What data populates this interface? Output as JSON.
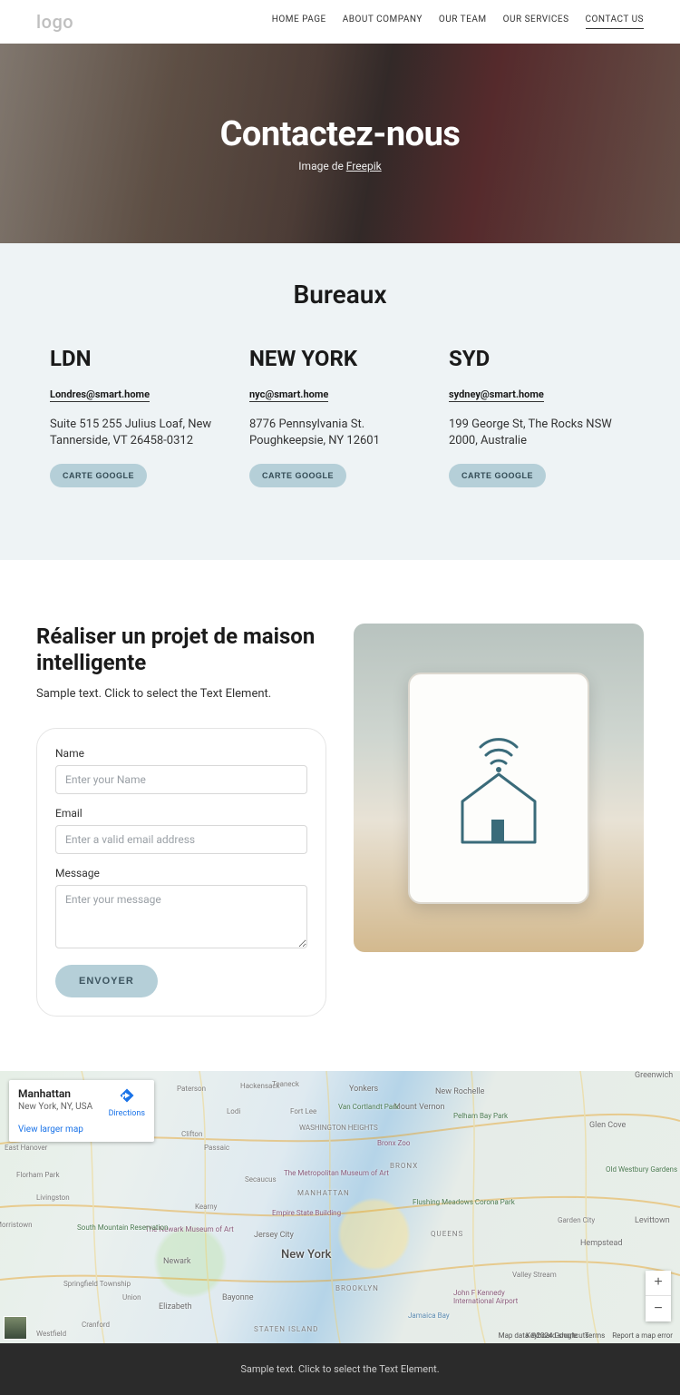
{
  "header": {
    "logo": "logo",
    "nav": [
      "HOME PAGE",
      "ABOUT COMPANY",
      "OUR TEAM",
      "OUR SERVICES",
      "CONTACT US"
    ]
  },
  "hero": {
    "title": "Contactez-nous",
    "credit_prefix": "Image de ",
    "credit_link": "Freepik"
  },
  "offices": {
    "heading": "Bureaux",
    "items": [
      {
        "city": "LDN",
        "email": "Londres@smart.home",
        "address": "Suite 515 255 Julius Loaf, New Tannerside, VT 26458-0312",
        "btn": "CARTE GOOGLE"
      },
      {
        "city": "NEW YORK",
        "email": "nyc@smart.home",
        "address": "8776 Pennsylvania St. Poughkeepsie, NY 12601",
        "btn": "CARTE GOOGLE"
      },
      {
        "city": "SYD",
        "email": "sydney@smart.home",
        "address": "199 George St, The Rocks NSW 2000, Australie",
        "btn": "CARTE GOOGLE"
      }
    ]
  },
  "project": {
    "heading": "Réaliser un projet de maison intelligente",
    "sample": "Sample text. Click to select the Text Element.",
    "form": {
      "name_label": "Name",
      "name_placeholder": "Enter your Name",
      "email_label": "Email",
      "email_placeholder": "Enter a valid email address",
      "message_label": "Message",
      "message_placeholder": "Enter your message",
      "submit": "ENVOYER"
    }
  },
  "map": {
    "card_title": "Manhattan",
    "card_sub": "New York, NY, USA",
    "card_larger": "View larger map",
    "card_dir": "Directions",
    "big_label": "New York",
    "labels": {
      "newark": "Newark",
      "brooklyn": "BROOKLYN",
      "queens": "QUEENS",
      "manhattan": "MANHATTAN",
      "jersey": "Jersey City",
      "bronx": "BRONX",
      "yonkers": "Yonkers",
      "mtvernon": "Mount Vernon",
      "newrochelle": "New Rochelle",
      "hempstead": "Hempstead",
      "levittown": "Levittown",
      "westbury": "Old Westbury Gardens",
      "pelham": "Pelham Bay Park",
      "vancort": "Van Cortlandt Park",
      "wash": "WASHINGTON HEIGHTS",
      "staten": "STATEN ISLAND",
      "bayonne": "Bayonne",
      "elizabeth": "Elizabeth",
      "springfield": "Springfield Township",
      "easthan": "East Hanover",
      "livingston": "Livingston",
      "morris": "Morristown",
      "florham": "Florham Park",
      "glencove": "Glen Cove",
      "greenwich": "Greenwich",
      "moma": "The Metropolitan Museum of Art",
      "esb": "Empire State Building",
      "newarkmus": "The Newark Museum of Art",
      "flushing": "Flushing Meadows Corona Park",
      "somr": "South Mountain Reservation",
      "bronxz": "Bronx Zoo",
      "westfield": "Westfield",
      "cranford": "Cranford",
      "union": "Union",
      "kearny": "Kearny",
      "clifton": "Clifton",
      "passaic": "Passaic",
      "paterson": "Paterson",
      "lodi": "Lodi",
      "secaucus": "Secaucus",
      "fortlee": "Fort Lee",
      "teaneck": "Teaneck",
      "hackensack": "Hackensack",
      "garden": "Garden City",
      "valley": "Valley Stream",
      "jfk": "John F Kennedy International Airport",
      "jamaica": "Jamaica Bay"
    },
    "zoom_in": "+",
    "zoom_out": "−",
    "kb": "Keyboard shortcuts",
    "attrib": "Map data ©2024 Google",
    "terms": "Terms",
    "report": "Report a map error"
  },
  "footer": {
    "text": "Sample text. Click to select the Text Element."
  }
}
